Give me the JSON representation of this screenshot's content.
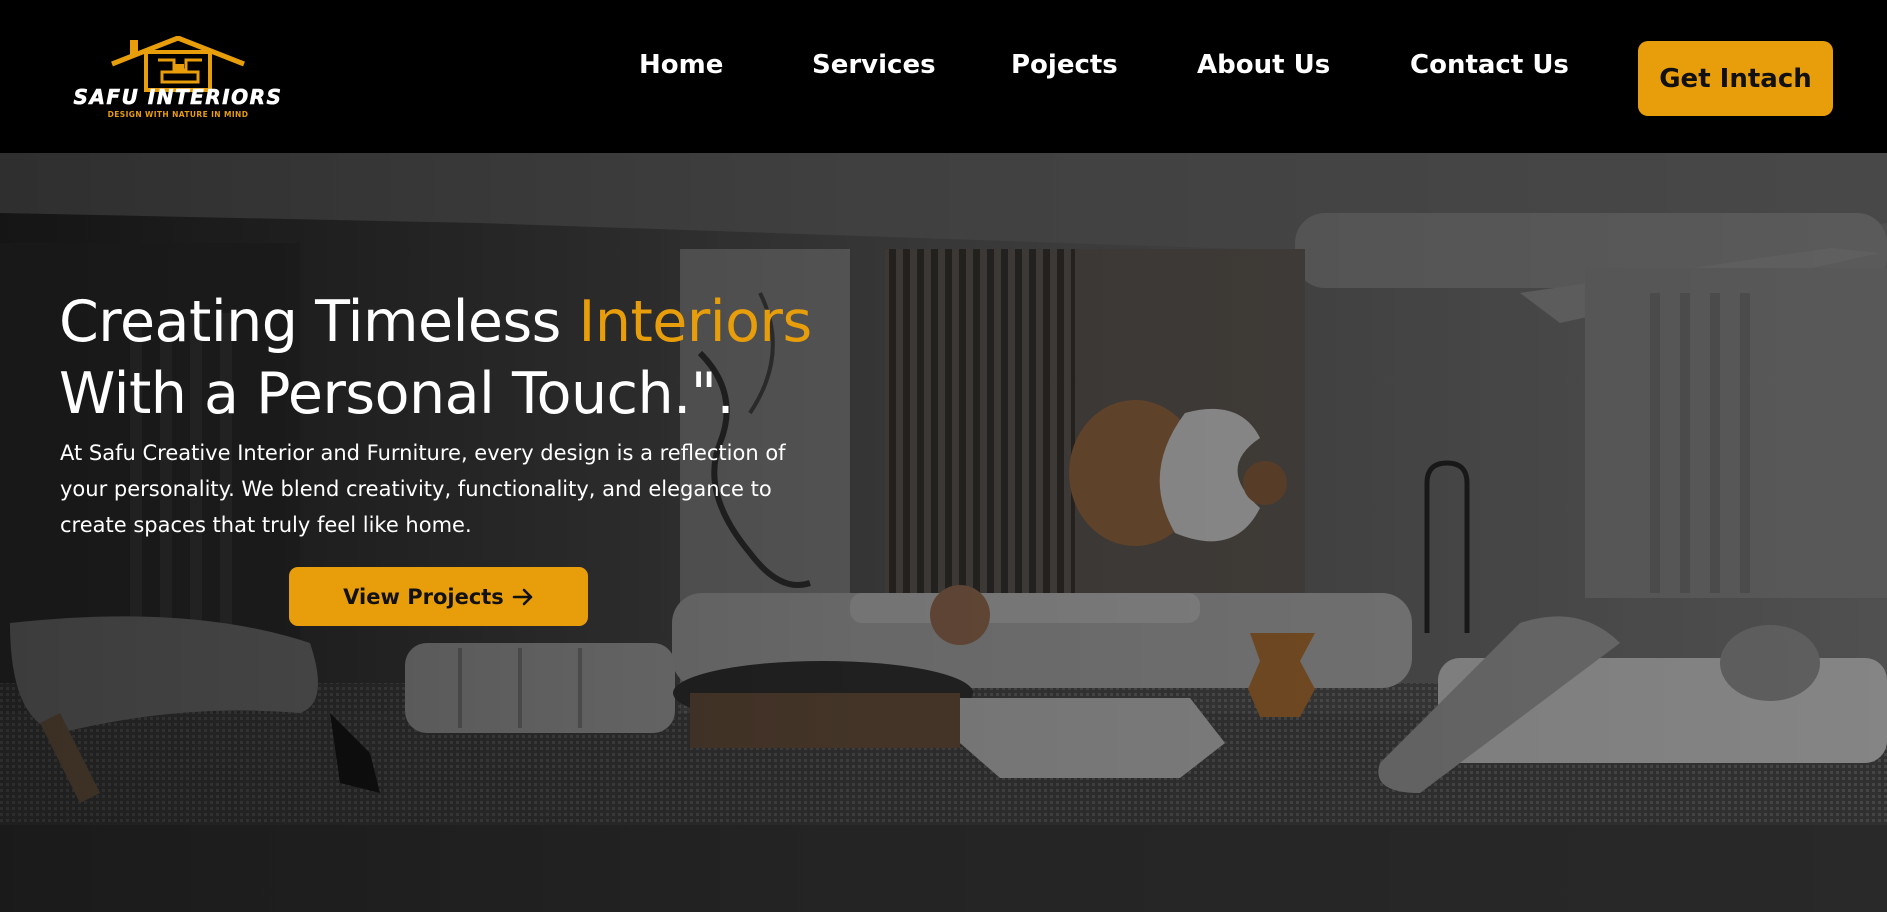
{
  "brand": {
    "name": "SAFU INTERIORS",
    "tagline": "DESIGN WITH NATURE IN MIND",
    "accent_color": "#e89d0b",
    "logo_icon": "house-icon"
  },
  "nav": {
    "items": [
      {
        "label": "Home"
      },
      {
        "label": "Services"
      },
      {
        "label": "Pojects"
      },
      {
        "label": "About Us"
      },
      {
        "label": "Contact Us"
      }
    ],
    "cta_label": "Get Intach"
  },
  "hero": {
    "headline_part1": "Creating Timeless ",
    "headline_accent": "Interiors",
    "headline_part2": "With a Personal Touch.\".",
    "description": "At Safu Creative Interior and Furniture, every design is a reflection of your personality. We blend creativity, functionality, and elegance to create spaces that truly feel like home.",
    "button_label": "View Projects",
    "button_icon": "arrow-right-icon"
  }
}
